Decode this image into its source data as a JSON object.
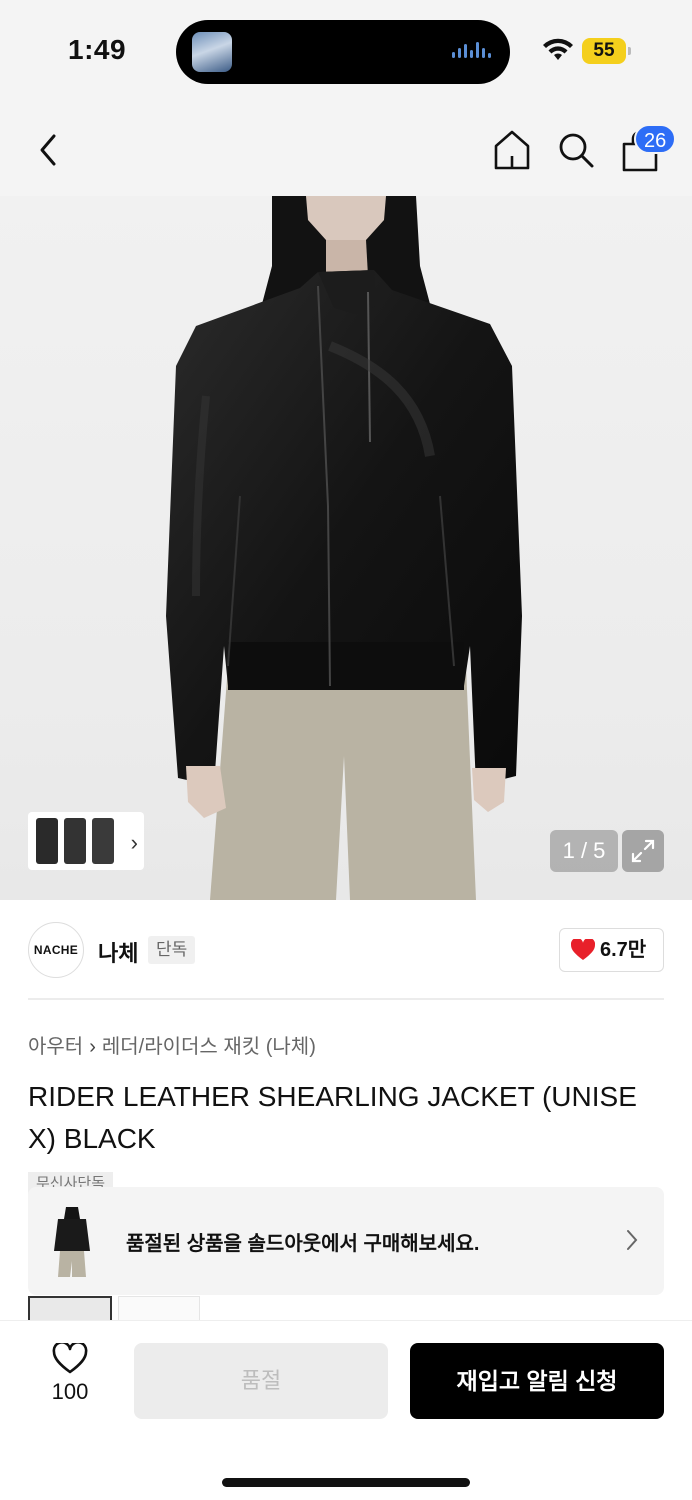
{
  "status_bar": {
    "time": "1:49",
    "battery": "55"
  },
  "nav": {
    "cart_count": "26"
  },
  "gallery": {
    "counter": "1 / 5"
  },
  "brand": {
    "logo_text": "NACHE",
    "name": "나체",
    "tag": "단독",
    "likes": "6.7만"
  },
  "breadcrumb": {
    "category": "아우터",
    "subcategory": "레더/라이더스 재킷 (나체)"
  },
  "product": {
    "title": "RIDER LEATHER SHEARLING JACKET (UNISEX) BLACK",
    "hidden_tag": "무신사단독"
  },
  "soldout_banner": {
    "text": "품절된 상품을 솔드아웃에서 구매해보세요."
  },
  "bottom_bar": {
    "wish_count": "100",
    "soldout_label": "품절",
    "restock_label": "재입고 알림 신청"
  },
  "colors": {
    "accent_blue": "#2d6df6",
    "heart_red": "#e8202a",
    "battery_yellow": "#f4cf1c"
  }
}
